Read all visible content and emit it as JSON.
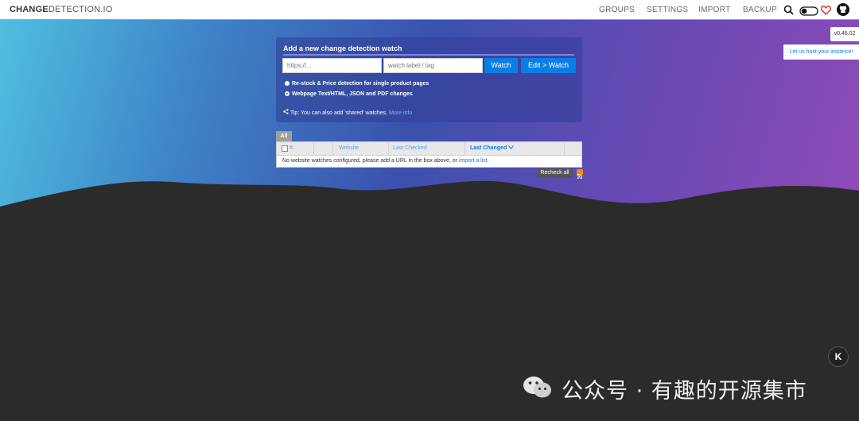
{
  "header": {
    "logo_bold": "CHANGE",
    "logo_rest": "DETECTION.IO",
    "nav": [
      "GROUPS",
      "SETTINGS",
      "IMPORT",
      "BACKUP"
    ]
  },
  "side": {
    "version": "v0.46.02",
    "host_link": "Let us host your instance!"
  },
  "form": {
    "title": "Add a new change detection watch",
    "url_placeholder": "https://...",
    "tag_placeholder": "watch label / tag",
    "watch_button": "Watch",
    "edit_watch_button": "Edit > Watch",
    "option_restock": "Re-stock & Price detection for single product pages",
    "option_webpage": "Webpage Text/HTML, JSON and PDF changes",
    "tip_text": "Tip: You can also add 'shared' watches.",
    "tip_link": "More info"
  },
  "watchlist": {
    "tab_all": "All",
    "columns": [
      "#",
      "Website",
      "Last Checked",
      "Last Changed"
    ],
    "empty_text": "No website watches configured, please add a URL in the box above, or",
    "import_link": "import a list",
    "recheck_all": "Recheck all"
  },
  "watermark": {
    "text": "公众号 · 有趣的开源集市"
  },
  "colors": {
    "accent": "#0a7ee6",
    "dark_bg": "#2b2b2b"
  },
  "icons": [
    "search-icon",
    "theme-toggle-icon",
    "heart-icon",
    "github-icon",
    "share-icon",
    "rss-icon",
    "wechat-icon"
  ]
}
